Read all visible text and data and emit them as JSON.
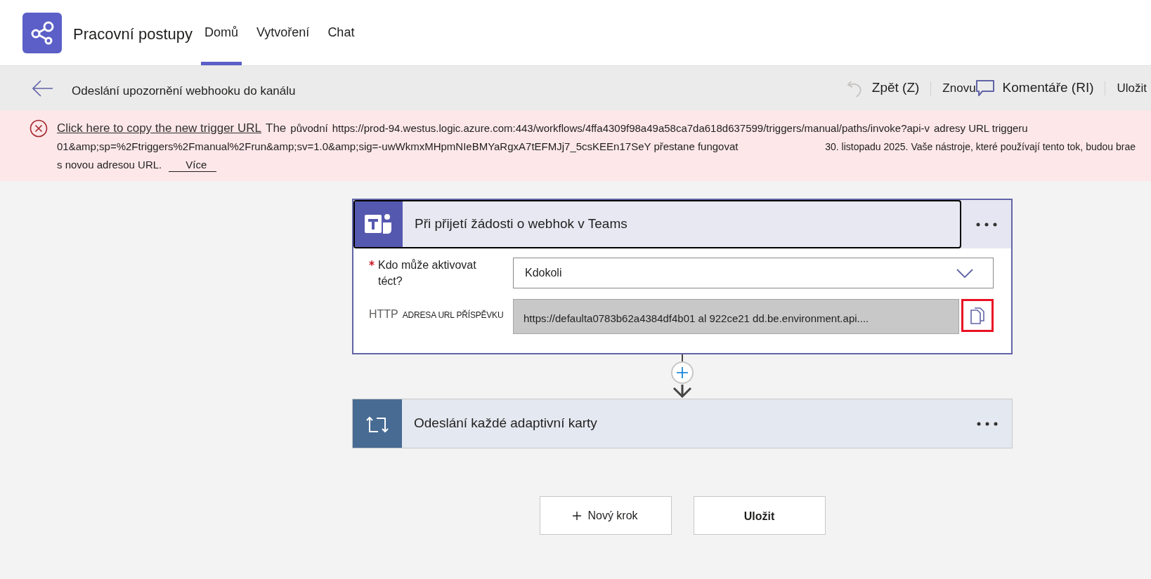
{
  "app": {
    "title": "Pracovní postupy"
  },
  "tabs": [
    {
      "label": "Domů",
      "selected": true
    },
    {
      "label": "Vytvoření",
      "selected": false
    },
    {
      "label": "Chat",
      "selected": false
    }
  ],
  "toolbar": {
    "title": "Odeslání upozornění webhooku do kanálu",
    "actions": [
      {
        "kind": "undo",
        "label": "Zpět (Z)"
      },
      {
        "kind": "redo",
        "label": "Znovu"
      },
      {
        "kind": "comments",
        "label": "Komentáře (RI)"
      },
      {
        "kind": "save",
        "label": "Uložit"
      }
    ]
  },
  "error_banner": {
    "lines": [
      [
        {
          "kind": "link",
          "text": "Click here to copy the new trigger URL"
        },
        {
          "kind": "lead",
          "text": "The"
        },
        {
          "kind": "text",
          "text": "původní"
        },
        {
          "kind": "text",
          "text": "https://prod-94.westus.logic.azure.com:443/workflows/4ffa4309f98a49a58ca7da618d637599/triggers/manual/paths/invoke?api-v"
        },
        {
          "kind": "text",
          "text": "adresy URL triggeru"
        }
      ],
      [
        {
          "kind": "text",
          "text": "01&amp;sp=%2Ftriggers%2Fmanual%2Frun&amp;sv=1.0&amp;sig=-uwWkmxMHpmNIeBMYaRgxA7tEFMJj7_5csKEEn17SeY přestane fungovat"
        },
        {
          "kind": "note",
          "text": "30. listopadu 2025. Vaše nástroje, které používají tento tok, budou brae"
        }
      ],
      [
        {
          "kind": "text",
          "text": "s novou adresou URL."
        },
        {
          "kind": "more_link",
          "text": "Více"
        }
      ]
    ]
  },
  "flow": {
    "steps": [
      {
        "kind": "teams_trigger",
        "title": "Při přijetí žádosti o webhok v Teams",
        "expanded": true,
        "fields": [
          {
            "kind": "dropdown",
            "label": "Kdo může aktivovat téct?",
            "required": true,
            "value": "Kdokoli"
          },
          {
            "kind": "copy_url",
            "label": "HTTP",
            "sublabel": "ADRESA URL PŘÍSPĚVKU",
            "value": "https://defaulta0783b62a4384df4b01 al 922ce21 dd.be.environment.api...."
          }
        ]
      },
      {
        "kind": "loop",
        "title": "Odeslání každé adaptivní karty",
        "expanded": false
      }
    ]
  },
  "buttons": [
    {
      "kind": "add",
      "label": "Nový krok"
    },
    {
      "kind": "save",
      "label": "Uložit"
    }
  ]
}
